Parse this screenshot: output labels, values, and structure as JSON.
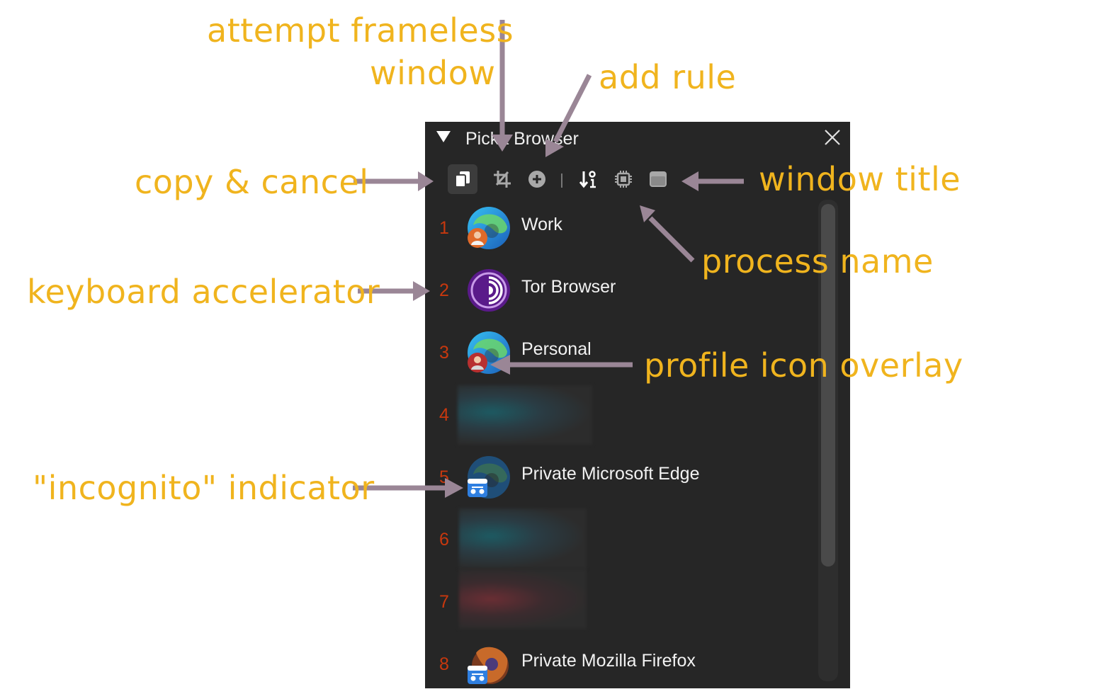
{
  "window": {
    "title": "Picka Browser"
  },
  "toolbar": {
    "buttons": [
      {
        "icon": "copy-icon"
      },
      {
        "icon": "crop-icon"
      },
      {
        "icon": "add-circle-icon"
      },
      {
        "icon": "sort-icon"
      },
      {
        "icon": "chip-icon"
      },
      {
        "icon": "window-icon"
      }
    ]
  },
  "browsers": [
    {
      "number": "1",
      "label": "Work",
      "icon": "edge-icon",
      "overlay": "profile-avatar"
    },
    {
      "number": "2",
      "label": "Tor Browser",
      "icon": "tor-icon"
    },
    {
      "number": "3",
      "label": "Personal",
      "icon": "edge-icon",
      "overlay": "profile-avatar"
    },
    {
      "number": "4",
      "label": ""
    },
    {
      "number": "5",
      "label": "Private Microsoft Edge",
      "icon": "edge-icon",
      "overlay": "incognito-icon"
    },
    {
      "number": "6",
      "label": ""
    },
    {
      "number": "7",
      "label": ""
    },
    {
      "number": "8",
      "label": "Private Mozilla Firefox",
      "icon": "firefox-icon",
      "overlay": "incognito-icon"
    }
  ],
  "annotations": {
    "frameless_line1": "attempt frameless",
    "frameless_line2": "window",
    "add_rule": "add rule",
    "copy_cancel": "copy & cancel",
    "window_title": "window title",
    "process_name": "process name",
    "keyboard_accelerator": "keyboard accelerator",
    "profile_icon_overlay": "profile icon overlay",
    "incognito_indicator": "\"incognito\" indicator"
  },
  "colors": {
    "panel_bg": "#262626",
    "accent_number": "#c8380e",
    "annotation_text": "#f0b41e",
    "arrow": "#9a8696"
  }
}
